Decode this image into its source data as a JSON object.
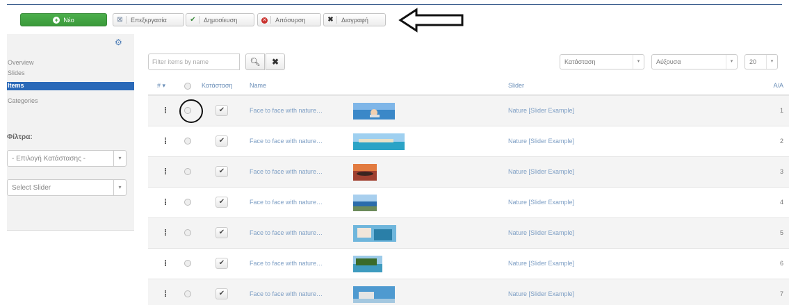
{
  "toolbar": {
    "new_label": "Νέο",
    "edit_label": "Επεξεργασία",
    "publish_label": "Δημοσίευση",
    "unpublish_label": "Απόσυρση",
    "trash_label": "Διαγραφή"
  },
  "sidebar": {
    "items": [
      {
        "label": "Overview"
      },
      {
        "label": "Slides"
      },
      {
        "label": "Items"
      },
      {
        "label": "Categories"
      }
    ],
    "filter_title": "Φίλτρα:",
    "state_select": "- Επιλογή Κατάστασης -",
    "slider_select": "Select Slider"
  },
  "filter": {
    "placeholder": "Filter items by name"
  },
  "sort": {
    "field": "Κατάσταση",
    "direction": "Αύξουσα",
    "limit": "20"
  },
  "table": {
    "headers": {
      "order": "#",
      "status": "Κατάσταση",
      "name": "Name",
      "slider": "Slider",
      "aa": "A/A"
    },
    "rows": [
      {
        "name": "Face to face with nature…",
        "slider": "Nature [Slider Example]",
        "aa": "1"
      },
      {
        "name": "Face to face with nature…",
        "slider": "Nature [Slider Example]",
        "aa": "2"
      },
      {
        "name": "Face to face with nature…",
        "slider": "Nature [Slider Example]",
        "aa": "3"
      },
      {
        "name": "Face to face with nature…",
        "slider": "Nature [Slider Example]",
        "aa": "4"
      },
      {
        "name": "Face to face with nature…",
        "slider": "Nature [Slider Example]",
        "aa": "5"
      },
      {
        "name": "Face to face with nature…",
        "slider": "Nature [Slider Example]",
        "aa": "6"
      },
      {
        "name": "Face to face with nature…",
        "slider": "Nature [Slider Example]",
        "aa": "7"
      }
    ]
  },
  "icons": {
    "search": "search-icon",
    "clear": "close-icon",
    "gear": "gear-icon",
    "publish": "check-icon",
    "drag": "drag-handle-icon"
  },
  "colors": {
    "new_button": "#3b9a3b",
    "active_sidebar": "#2a69b8",
    "link": "#7d9ec4"
  }
}
